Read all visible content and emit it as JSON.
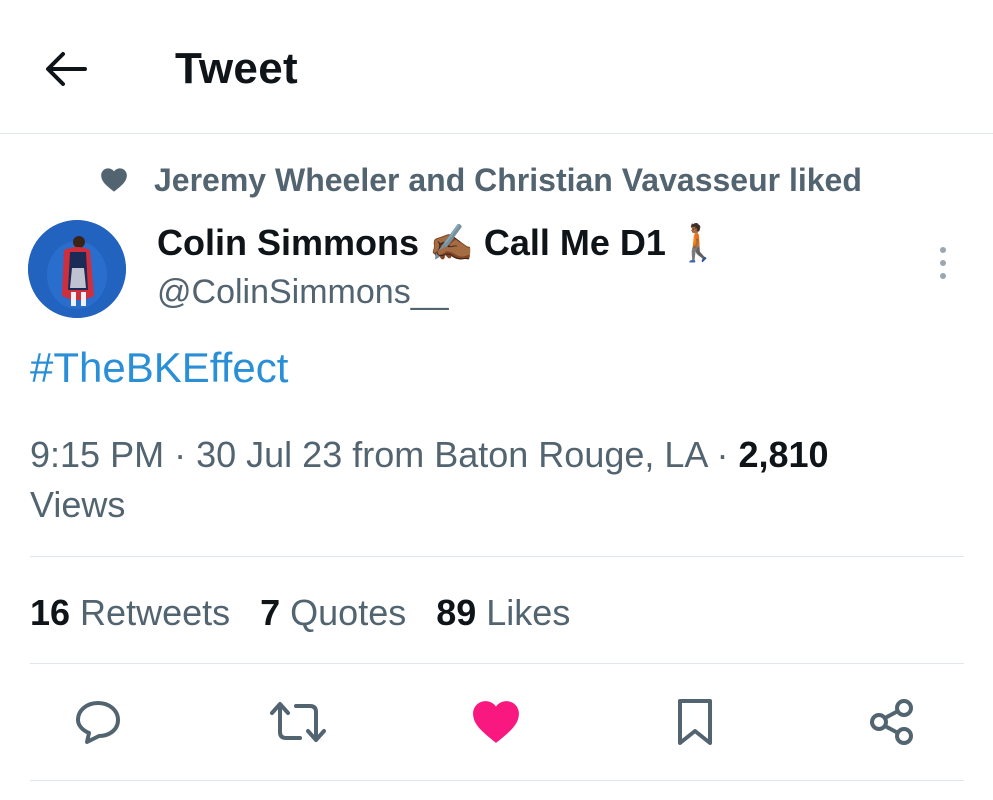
{
  "header": {
    "title": "Tweet",
    "back_icon": "arrow-left-icon"
  },
  "social_context": {
    "icon": "heart-icon",
    "text": "Jeremy Wheeler and Christian Vavasseur liked"
  },
  "author": {
    "name": "Colin Simmons",
    "name_suffix": "Call Me D1",
    "emoji_1": "✍🏾",
    "emoji_2": "🚶🏾",
    "handle": "@ColinSimmons__"
  },
  "tweet": {
    "text": "#TheBKEffect"
  },
  "meta": {
    "time": "9:15 PM",
    "sep1": "·",
    "date_source": "30 Jul 23 from Baton Rouge, LA",
    "sep2": "·",
    "views_count": "2,810",
    "views_label": "Views"
  },
  "stats": {
    "retweets_count": "16",
    "retweets_label": "Retweets",
    "quotes_count": "7",
    "quotes_label": "Quotes",
    "likes_count": "89",
    "likes_label": "Likes"
  },
  "actions": [
    {
      "name": "reply-icon"
    },
    {
      "name": "retweet-icon"
    },
    {
      "name": "like-icon",
      "active": true,
      "color": "#f91880"
    },
    {
      "name": "bookmark-icon"
    },
    {
      "name": "share-icon"
    }
  ],
  "colors": {
    "link": "#1d9bf0",
    "muted": "#536471",
    "like": "#f91880",
    "text": "#0f1419"
  }
}
